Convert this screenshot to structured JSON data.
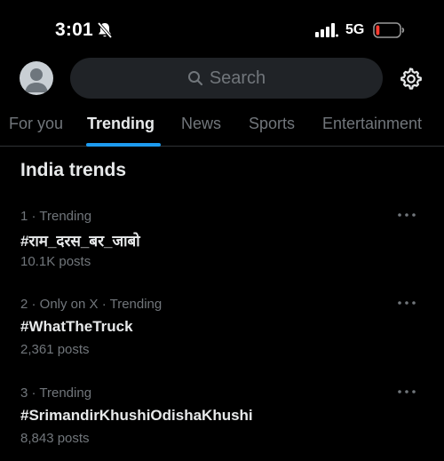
{
  "status_bar": {
    "time": "3:01",
    "network": "5G",
    "battery_level": 0.15,
    "battery_color": "#ff3b30",
    "icons": [
      "bell-slash-icon",
      "signal-icon",
      "battery-icon"
    ]
  },
  "header": {
    "search_placeholder": "Search",
    "icons": [
      "avatar",
      "search-icon",
      "settings-gear-icon"
    ]
  },
  "tabs": [
    {
      "label": "For you",
      "active": false
    },
    {
      "label": "Trending",
      "active": true
    },
    {
      "label": "News",
      "active": false
    },
    {
      "label": "Sports",
      "active": false
    },
    {
      "label": "Entertainment",
      "active": false
    }
  ],
  "section": {
    "title": "India trends"
  },
  "trends": [
    {
      "meta": "1 · Trending",
      "name": "#राम_दरस_बर_जाबो",
      "posts": "10.1K posts"
    },
    {
      "meta": "2 · Only on X · Trending",
      "name": "#WhatTheTruck",
      "posts": "2,361 posts"
    },
    {
      "meta": "3 · Trending",
      "name": "#SrimandirKhushiOdishaKhushi",
      "posts": "8,843 posts"
    }
  ],
  "colors": {
    "background": "#000000",
    "accent": "#1d9bf0",
    "text_primary": "#e7e9ea",
    "text_secondary": "#71767b",
    "search_bg": "#202327"
  }
}
